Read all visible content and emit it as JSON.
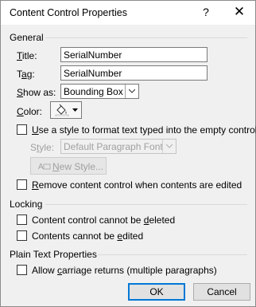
{
  "window": {
    "title": "Content Control Properties",
    "help_glyph": "?",
    "close_glyph": "✕"
  },
  "general": {
    "heading": "General",
    "title_label_hotkey": "T",
    "title_label_rest": "itle:",
    "title_value": "SerialNumber",
    "tag_label_pre": "T",
    "tag_label_hotkey": "a",
    "tag_label_rest": "g:",
    "tag_value": "SerialNumber",
    "show_as_label_hotkey": "S",
    "show_as_label_rest": "how as:",
    "show_as_value": "Bounding Box",
    "color_label_hotkey": "C",
    "color_label_rest": "olor:",
    "use_style_hotkey": "U",
    "use_style_rest": "se a style to format text typed into the empty control",
    "style_label_pre": "S",
    "style_label_hotkey": "t",
    "style_label_rest": "yle:",
    "style_value": "Default Paragraph Font",
    "new_style_hotkey": "N",
    "new_style_rest": "ew Style...",
    "remove_pre": "",
    "remove_hotkey": "R",
    "remove_rest": "emove content control when contents are edited"
  },
  "locking": {
    "heading": "Locking",
    "cannot_delete_pre": "Content control cannot be ",
    "cannot_delete_hotkey": "d",
    "cannot_delete_rest": "eleted",
    "cannot_edit_pre": "Contents cannot be ",
    "cannot_edit_hotkey": "e",
    "cannot_edit_rest": "dited"
  },
  "plain_text": {
    "heading": "Plain Text Properties",
    "allow_cr_pre": "Allow ",
    "allow_cr_hotkey": "c",
    "allow_cr_rest": "arriage returns (multiple paragraphs)"
  },
  "buttons": {
    "ok": "OK",
    "cancel": "Cancel"
  },
  "colors": {
    "focus_border": "#0078d7",
    "disabled_text": "#a0a0a0"
  }
}
